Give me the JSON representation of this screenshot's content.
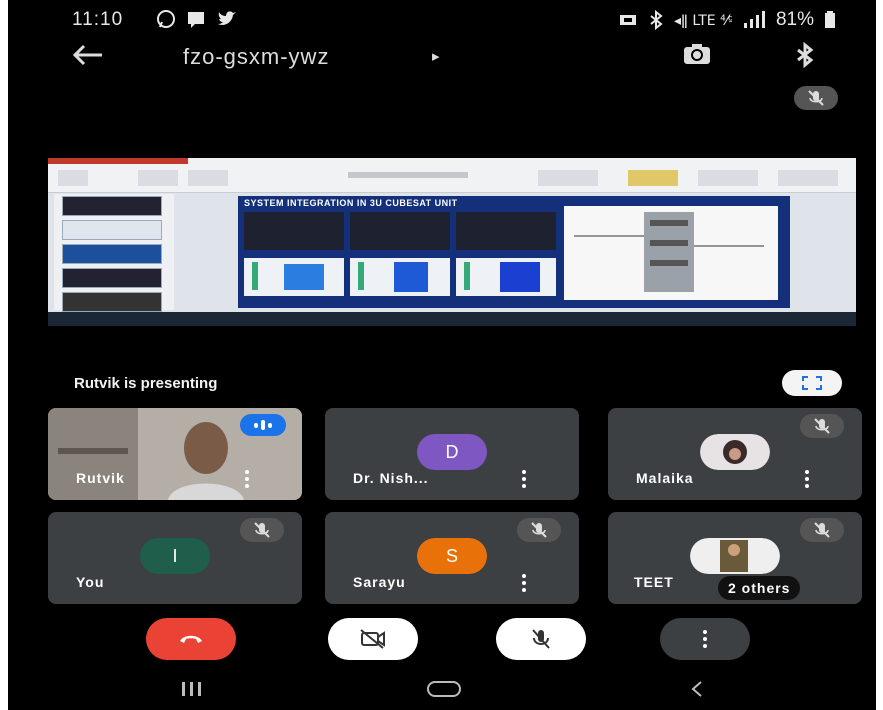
{
  "status_bar": {
    "time": "11:10",
    "battery": "81%",
    "left_icons": [
      "whatsapp-icon",
      "message-icon",
      "twitter-icon"
    ],
    "right_icons": [
      "sync-icon",
      "bluetooth-icon",
      "volte-icon",
      "signal-icon",
      "battery-icon"
    ]
  },
  "header": {
    "meeting_code": "fzo-gsxm-ywz",
    "arrow": "▸",
    "back_icon": "arrow-left-icon",
    "actions": [
      "switch-camera-icon",
      "bluetooth-icon"
    ]
  },
  "presentation": {
    "label": "Rutvik is presenting",
    "slide_title": "SYSTEM INTEGRATION IN 3U CUBESAT UNIT"
  },
  "participants": [
    {
      "name": "Rutvik",
      "type": "video",
      "speaking": true
    },
    {
      "name": "Dr. Nish...",
      "initial": "D",
      "color": "#7e57c2",
      "muted": false
    },
    {
      "name": "Malaika",
      "type": "photo",
      "muted": true
    },
    {
      "name": "You",
      "initial": "I",
      "color": "#1e5e4a",
      "muted": true
    },
    {
      "name": "Sarayu",
      "initial": "S",
      "color": "#e8710a",
      "muted": true
    },
    {
      "name": "TEET",
      "others": "2 others",
      "type": "photo",
      "muted": true
    }
  ],
  "controls": [
    "end-call-icon",
    "camera-off-icon",
    "mic-off-icon",
    "more-options-icon"
  ],
  "colors": {
    "end_call": "#ea4335",
    "tile": "#3c4043",
    "speaking": "#1a73e8"
  }
}
